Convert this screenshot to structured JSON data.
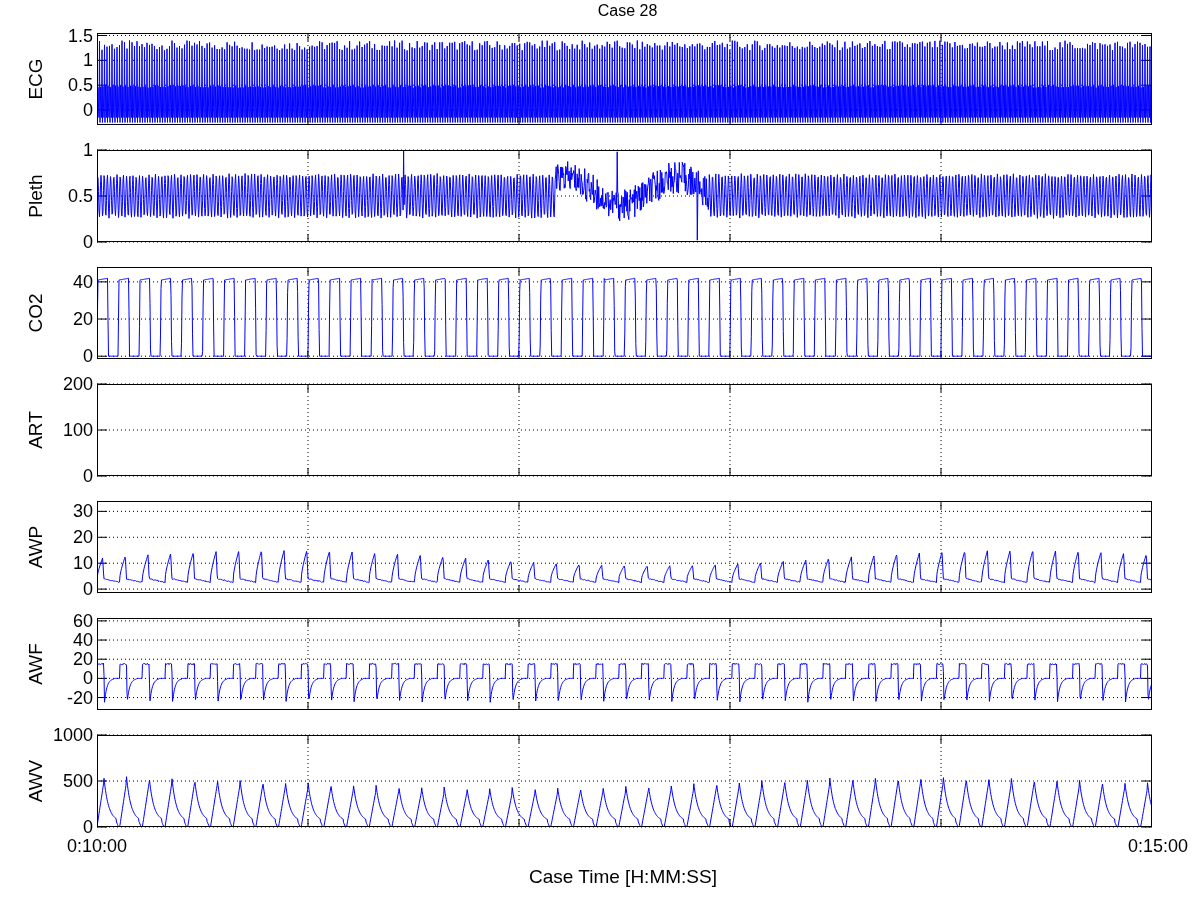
{
  "title": "Case 28",
  "panels": [
    {
      "kind": "ecg",
      "ylabel": "ECG",
      "yticks": [
        "1.5",
        "1",
        "0.5",
        "0"
      ]
    },
    {
      "kind": "pleth",
      "ylabel": "Pleth",
      "yticks": [
        "1",
        "0.5",
        "0"
      ]
    },
    {
      "kind": "co2",
      "ylabel": "CO2",
      "yticks": [
        "40",
        "20",
        "0"
      ]
    },
    {
      "kind": "art",
      "ylabel": "ART",
      "yticks": [
        "200",
        "100",
        "0"
      ]
    },
    {
      "kind": "awp",
      "ylabel": "AWP",
      "yticks": [
        "30",
        "20",
        "10",
        "0"
      ]
    },
    {
      "kind": "awf",
      "ylabel": "AWF",
      "yticks": [
        "60",
        "40",
        "20",
        "0",
        "-20"
      ]
    },
    {
      "kind": "awv",
      "ylabel": "AWV",
      "yticks": [
        "1000",
        "500",
        "0"
      ]
    }
  ],
  "xticks": [
    "0:10:00",
    "0:15:00"
  ],
  "xlabel": "Case Time [H:MM:SS]"
}
